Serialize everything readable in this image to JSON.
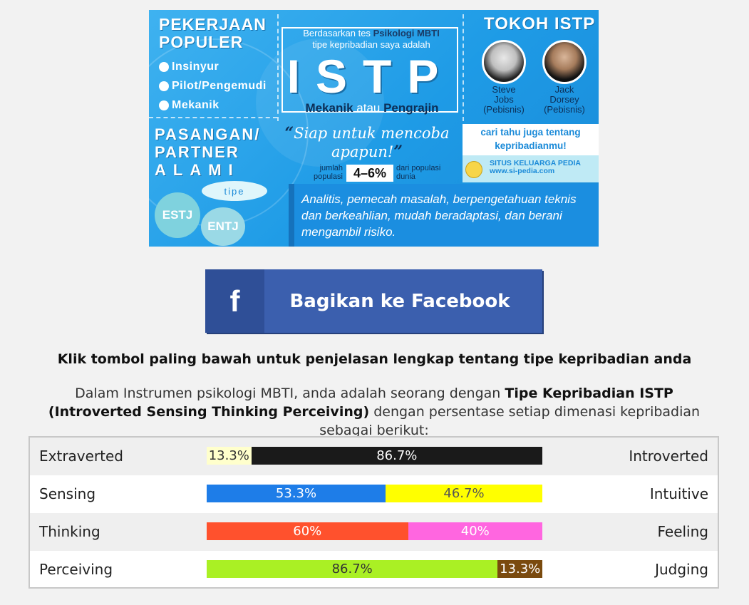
{
  "banner": {
    "pekerjaan_title_1": "PEKERJAAN",
    "pekerjaan_title_2": "POPULER",
    "jobs": [
      "Insinyur",
      "Pilot/Pengemudi",
      "Mekanik"
    ],
    "intro_1": "Berdasarkan tes",
    "intro_bold_1": "Psikologi MBTI",
    "intro_2": "tipe kepribadian",
    "intro_3": "saya adalah",
    "type": "ISTP",
    "role_1": "Mekanik",
    "role_sep": "atau",
    "role_2": "Pengrajin",
    "tokoh_title": "TOKOH ISTP",
    "figures": [
      {
        "name_1": "Steve",
        "name_2": "Jobs",
        "role": "(Pebisnis)"
      },
      {
        "name_1": "Jack",
        "name_2": "Dorsey",
        "role": "(Pebisnis)"
      }
    ],
    "pasangan_1": "PASANGAN/",
    "pasangan_2": "PARTNER",
    "pasangan_3": "ALAMI",
    "tipe_label": "tipe",
    "partners": [
      "ESTJ",
      "ENTJ"
    ],
    "quote": "Siap untuk mencoba apapun!",
    "pop_label_1": "jumlah",
    "pop_label_2": "populasi",
    "pop_pct": "4–6%",
    "pop_label_3": "dari populasi",
    "pop_label_4": "dunia",
    "cari": "cari tahu juga tentang kepribadianmu!",
    "situs_1": "SITUS KELUARGA PEDIA",
    "situs_2": "www.si-pedia.com",
    "description": "Analitis, pemecah masalah, berpengetahuan teknis dan berkeahlian, mudah beradaptasi, dan berani mengambil risiko.",
    "colors": {
      "bg": "#1e9be6",
      "dark_text": "#0d2f57"
    }
  },
  "share": {
    "icon": "facebook-icon",
    "label": "Bagikan ke Facebook",
    "color": "#3b5fae"
  },
  "instruction": "Klik tombol paling bawah untuk penjelasan lengkap tentang tipe kepribadian anda",
  "result": {
    "pre": "Dalam Instrumen psikologi MBTI, anda adalah seorang dengan ",
    "bold": "Tipe Kepribadian ISTP (Introverted Sensing Thinking Perceiving)",
    "post": " dengan persentase setiap dimenasi kepribadian sebagai berikut:"
  },
  "dimensions": [
    {
      "left": "Extraverted",
      "right": "Introverted",
      "segments": [
        {
          "pct": 13.3,
          "label": "13.3%",
          "bg": "#ffffcc",
          "fg": "#333333"
        },
        {
          "pct": 86.7,
          "label": "86.7%",
          "bg": "#1a1a1a",
          "fg": "#ffffff"
        }
      ]
    },
    {
      "left": "Sensing",
      "right": "Intuitive",
      "segments": [
        {
          "pct": 53.3,
          "label": "53.3%",
          "bg": "#1e7de8",
          "fg": "#ffffff"
        },
        {
          "pct": 46.7,
          "label": "46.7%",
          "bg": "#ffff00",
          "fg": "#555555"
        }
      ]
    },
    {
      "left": "Thinking",
      "right": "Feeling",
      "segments": [
        {
          "pct": 60,
          "label": "60%",
          "bg": "#ff512d",
          "fg": "#ffffff"
        },
        {
          "pct": 40,
          "label": "40%",
          "bg": "#ff66e0",
          "fg": "#ffffff"
        }
      ]
    },
    {
      "left": "Perceiving",
      "right": "Judging",
      "segments": [
        {
          "pct": 86.7,
          "label": "86.7%",
          "bg": "#aaf024",
          "fg": "#333333"
        },
        {
          "pct": 13.3,
          "label": "13.3%",
          "bg": "#7a4a0e",
          "fg": "#ffffff"
        }
      ]
    }
  ]
}
